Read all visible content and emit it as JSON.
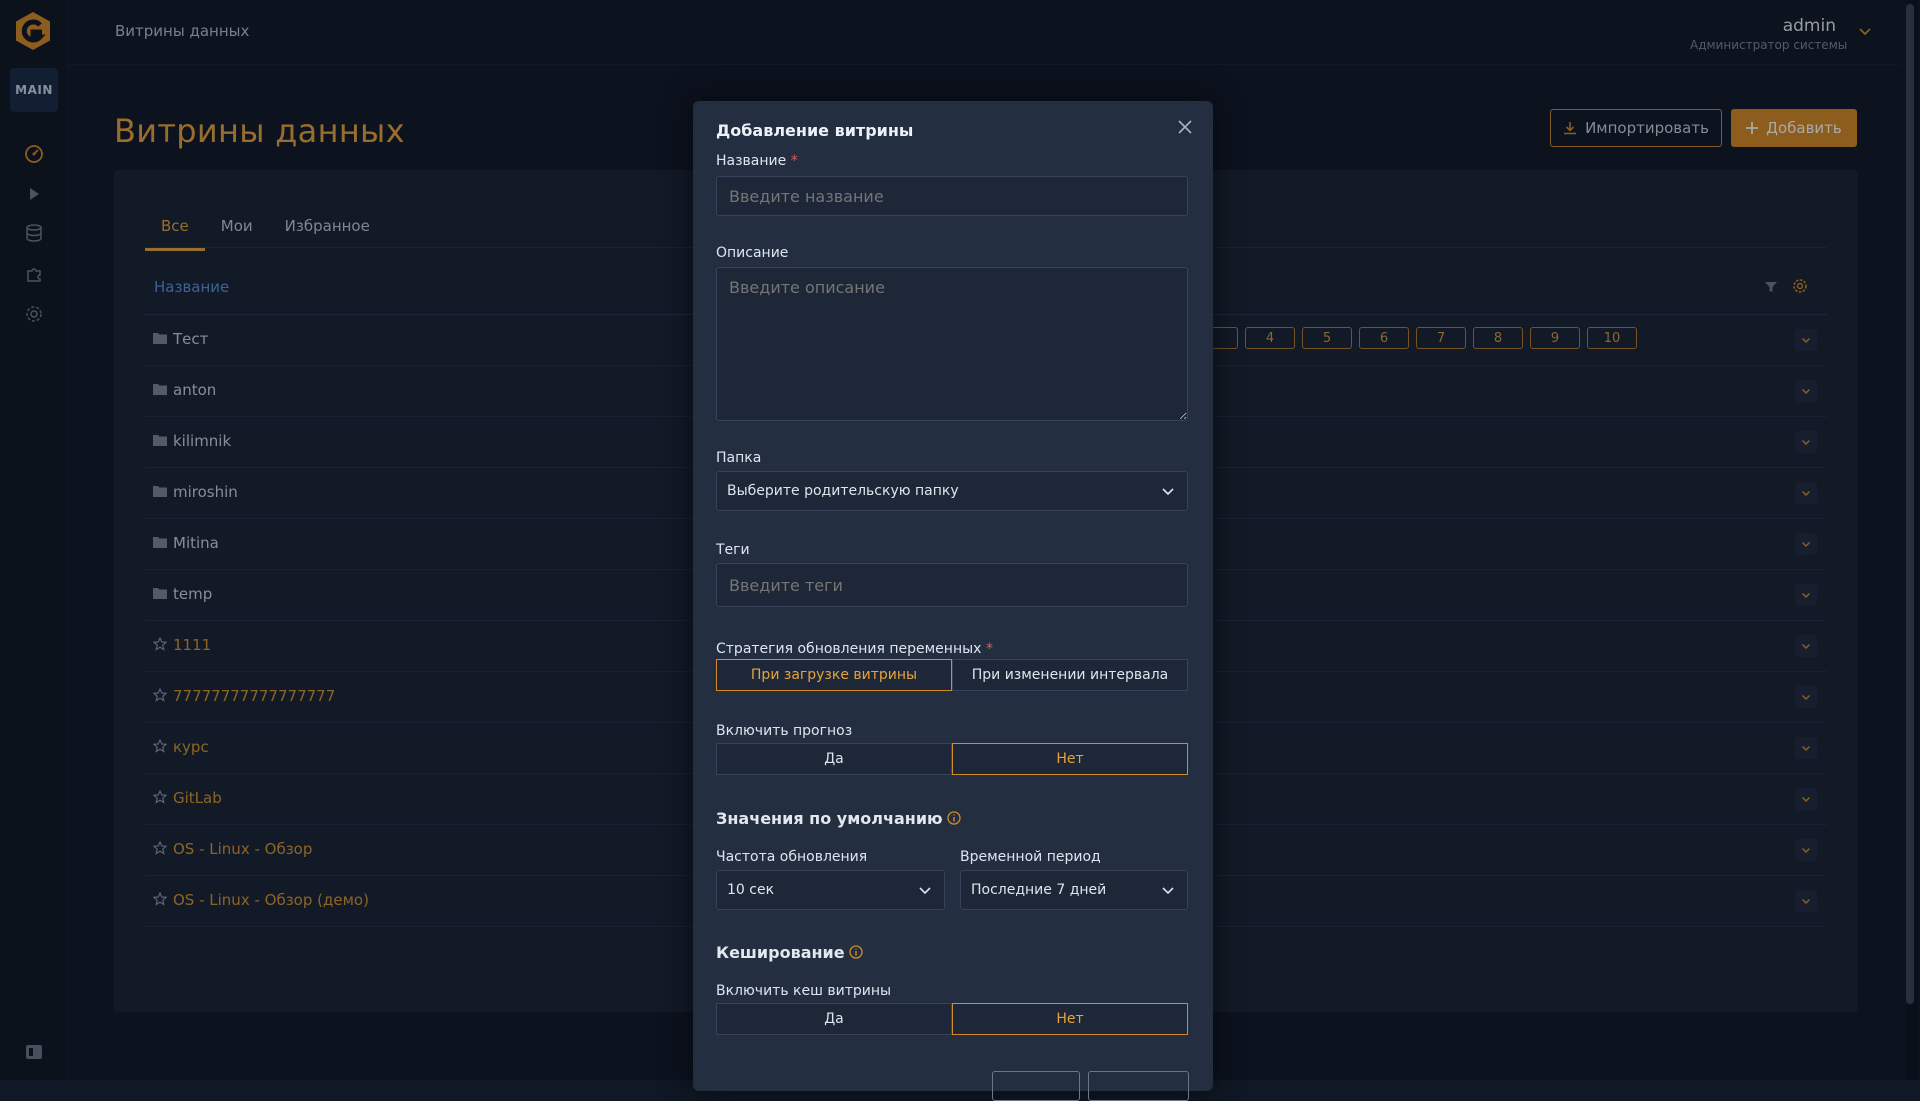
{
  "header": {
    "breadcrumb": "Витрины данных",
    "user_name": "admin",
    "user_role": "Администратор системы"
  },
  "sidebar": {
    "main_label": "MAIN",
    "icons": [
      "dashboard-icon",
      "play-icon",
      "database-icon",
      "puzzle-icon",
      "gear-icon"
    ]
  },
  "page": {
    "title": "Витрины данных",
    "import_label": "Импортировать",
    "add_label": "Добавить"
  },
  "tabs": [
    {
      "label": "Все",
      "active": true
    },
    {
      "label": "Мои",
      "active": false
    },
    {
      "label": "Избранное",
      "active": false
    }
  ],
  "table": {
    "column_name": "Название",
    "rows": [
      {
        "label": "Тест",
        "type": "folder"
      },
      {
        "label": "anton",
        "type": "folder"
      },
      {
        "label": "kilimnik",
        "type": "folder"
      },
      {
        "label": "miroshin",
        "type": "folder"
      },
      {
        "label": "Mitina",
        "type": "folder"
      },
      {
        "label": "temp",
        "type": "folder"
      },
      {
        "label": "1111",
        "type": "star"
      },
      {
        "label": "77777777777777777",
        "type": "star"
      },
      {
        "label": "курс",
        "type": "star"
      },
      {
        "label": "GitLab",
        "type": "star"
      },
      {
        "label": "OS - Linux - Обзор",
        "type": "star"
      },
      {
        "label": "OS - Linux - Обзор (демо)",
        "type": "star"
      }
    ]
  },
  "pagination": {
    "pages": [
      "4",
      "5",
      "6",
      "7",
      "8",
      "9",
      "10"
    ]
  },
  "modal": {
    "title": "Добавление витрины",
    "name_label": "Название",
    "name_placeholder": "Введите название",
    "desc_label": "Описание",
    "desc_placeholder": "Введите описание",
    "folder_label": "Папка",
    "folder_value": "Выберите родительскую папку",
    "tags_label": "Теги",
    "tags_placeholder": "Введите теги",
    "strategy_label": "Стратегия обновления переменных",
    "strategy_options": [
      "При загрузке витрины",
      "При изменении интервала"
    ],
    "strategy_selected": 0,
    "forecast_label": "Включить прогноз",
    "forecast_options": [
      "Да",
      "Нет"
    ],
    "forecast_selected": 1,
    "defaults_title": "Значения по умолчанию",
    "refresh_label": "Частота обновления",
    "refresh_value": "10 сек",
    "period_label": "Временной период",
    "period_value": "Последние 7 дней",
    "cache_title": "Кеширование",
    "cache_label": "Включить кеш витрины",
    "cache_options": [
      "Да",
      "Нет"
    ],
    "cache_selected": 1
  },
  "colors": {
    "accent": "#d48b24",
    "title": "#e6a33d",
    "link": "#5b8fe0",
    "bg": "#101825",
    "card": "#1a2434",
    "modal": "#232f41"
  }
}
